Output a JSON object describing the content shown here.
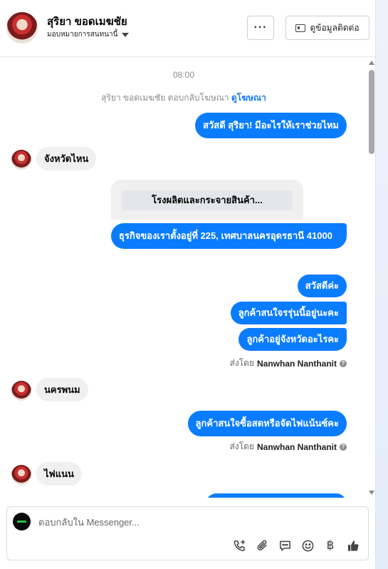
{
  "header": {
    "contact_name": "สุริยา ขอดเมฆชัย",
    "assign_label": "มอบหมายการสนทนานี้",
    "more_label": "···",
    "view_contact_label": "ดูข้อมูลติดต่อ"
  },
  "chat": {
    "time": "08:00",
    "system_note": "สุริยา ขอดเมฆชัย ตอบกลับโฆษณา",
    "system_link": "ดูโฆษณา",
    "messages": [
      {
        "dir": "out",
        "text": "สวัสดี สุริยา! มีอะไรให้เราช่วยไหม"
      },
      {
        "dir": "in",
        "text": "จังหวัดไหน"
      },
      {
        "dir": "template_button",
        "text": "โรงผลิตและกระจายสินค้า..."
      },
      {
        "dir": "out",
        "text": "ธุรกิจของเราตั้งอยู่ที่ 225, เทศบาลนครอุดรธานี 41000"
      },
      {
        "dir": "out",
        "text": "สวัสดีค่ะ"
      },
      {
        "dir": "out",
        "text": "ลูกค้าสนใจรรุ่นนี้อยู่นะคะ"
      },
      {
        "dir": "out",
        "text": "ลูกค้าอยู่จังหวัดอะไรคะ"
      },
      {
        "dir": "in",
        "text": "นครพนม"
      },
      {
        "dir": "out",
        "text": "ลูกค้าสนใจซื้อสดหรือจัดไฟแน้นซ์คะ"
      },
      {
        "dir": "in",
        "text": "ไฟแนน"
      }
    ],
    "sent_by_label": "ส่งโดย",
    "sent_by_name": "Nanwhan Nanthanit",
    "help_glyph": "?"
  },
  "composer": {
    "placeholder": "ตอบกลับใน Messenger...",
    "value": "",
    "baht_symbol": "฿",
    "tools": [
      "phone-plus-icon",
      "paperclip-icon",
      "saved-reply-icon",
      "emoji-icon",
      "baht-icon",
      "like-icon"
    ]
  }
}
